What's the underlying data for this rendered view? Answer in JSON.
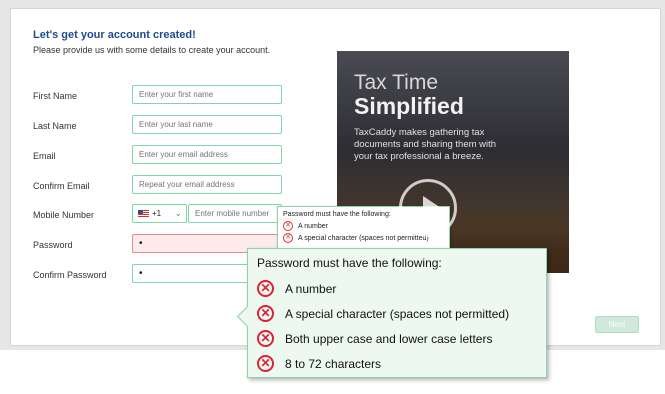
{
  "form": {
    "heading": "Let's get your account created!",
    "subheading": "Please provide us with some details to create your account.",
    "first_name": {
      "label": "First Name",
      "placeholder": "Enter your first name"
    },
    "last_name": {
      "label": "Last Name",
      "placeholder": "Enter your last name"
    },
    "email": {
      "label": "Email",
      "placeholder": "Enter your email address"
    },
    "confirm_email": {
      "label": "Confirm Email",
      "placeholder": "Repeat your email address"
    },
    "mobile": {
      "label": "Mobile Number",
      "country_code": "+1",
      "placeholder": "Enter mobile number"
    },
    "password": {
      "label": "Password",
      "value": "•"
    },
    "confirm_password": {
      "label": "Confirm Password",
      "value": "•"
    },
    "next_label": "Next"
  },
  "promo": {
    "title_line1": "Tax Time",
    "title_line2": "Simplified",
    "text": "TaxCaddy makes gathering tax documents and sharing them with your tax professional a breeze."
  },
  "password_rules_small": {
    "title": "Password must have the following:",
    "items": [
      "A number",
      "A special character (spaces not permitted)"
    ]
  },
  "password_rules": {
    "title": "Password must have the following:",
    "items": [
      "A number",
      "A special character (spaces not permitted)",
      "Both upper case and lower case letters",
      "8 to 72 characters"
    ]
  },
  "icons": {
    "rule_fail": "x-circle-icon",
    "chevron": "chevron-down-icon",
    "flag": "us-flag-icon",
    "play": "play-icon"
  },
  "colors": {
    "heading": "#1f4b8f",
    "field_border": "#7fd6a6",
    "error": "#d23",
    "tooltip_bg": "#edf8f1"
  }
}
